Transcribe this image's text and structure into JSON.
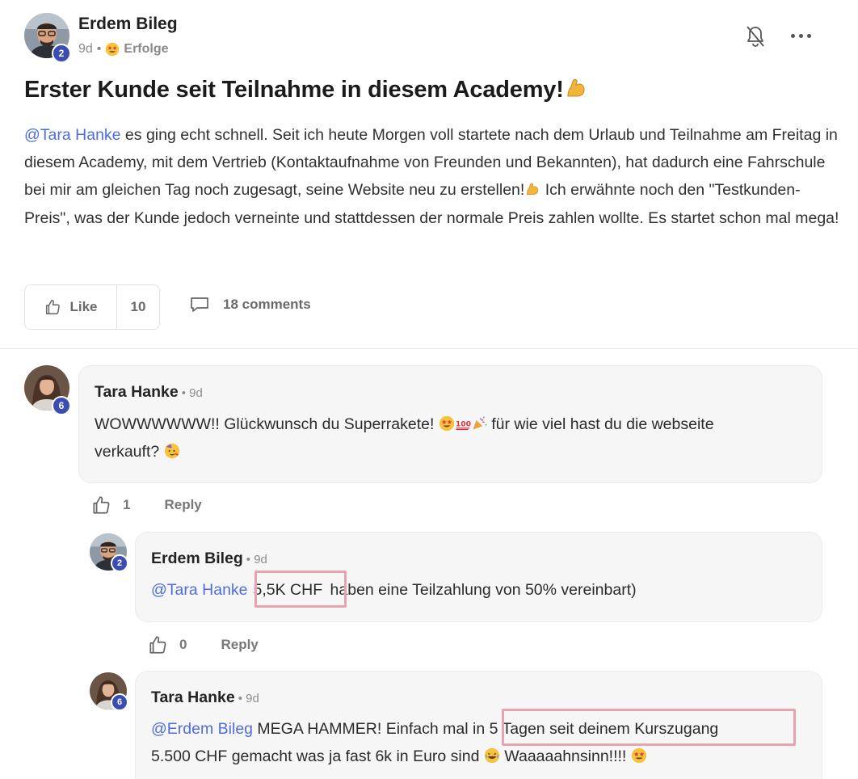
{
  "post": {
    "author": "Erdem Bileg",
    "level": "2",
    "time": "9d",
    "separator": "•",
    "category": "Erfolge",
    "title": "Erster Kunde seit Teilnahme in diesem Academy!",
    "title_emoji": "flexed-biceps",
    "body_mention": "@Tara Hanke",
    "body_part1": " es ging echt schnell. Seit ich heute Morgen voll startete nach dem Urlaub und Teilnahme am Freitag in diesem Academy, mit dem Vertrieb (Kontaktaufnahme von Freunden und Bekannten), hat dadurch eine Fahrschule bei mir am gleichen Tag noch zugesagt, seine Website neu zu erstellen!",
    "body_part2": " Ich erwähnte noch den \"Testkunden-Preis\", was der Kunde jedoch verneinte und stattdessen der normale Preis zahlen wollte. Es startet schon mal mega!",
    "like_label": "Like",
    "like_count": "10",
    "comments_label": "18 comments"
  },
  "comments": [
    {
      "author": "Tara Hanke",
      "level": "6",
      "time": "• 9d",
      "text_line1": "WOWWWWWW!! Glückwunsch du Superrakete! ",
      "text_line1b": " für wie viel hast du die webseite",
      "text_line2": "verkauft? ",
      "likes": "1",
      "reply_label": "Reply"
    },
    {
      "author": "Erdem Bileg",
      "level": "2",
      "time": "• 9d",
      "mention": "@Tara Hanke",
      "highlight": "5,5K CHF",
      "text_rest": " haben eine Teilzahlung von 50% vereinbart)",
      "likes": "0",
      "reply_label": "Reply"
    },
    {
      "author": "Tara Hanke",
      "level": "6",
      "time": "• 9d",
      "mention": "@Erdem Bileg",
      "text_a": " MEGA HAMMER! Einfach mal ",
      "highlight": "in 5 Tagen seit deinem Kurszugang",
      "text_line2a": "5.500 CHF gemacht was ja fast 6k in Euro sind ",
      "text_line2b": " Waaaaahnsinn!!!! "
    }
  ],
  "colors": {
    "mention": "#4f6de0",
    "level_badge": "#3b4db3",
    "highlight_box": "#e8a2b0",
    "bubble_bg": "#f6f6f6"
  },
  "icons": [
    "bell-off-icon",
    "more-icon",
    "thumbs-up-icon",
    "comment-icon",
    "star-struck-emoji",
    "hundred-emoji",
    "party-popper-emoji",
    "partying-face-emoji",
    "flexed-biceps-emoji",
    "laughing-emoji"
  ]
}
